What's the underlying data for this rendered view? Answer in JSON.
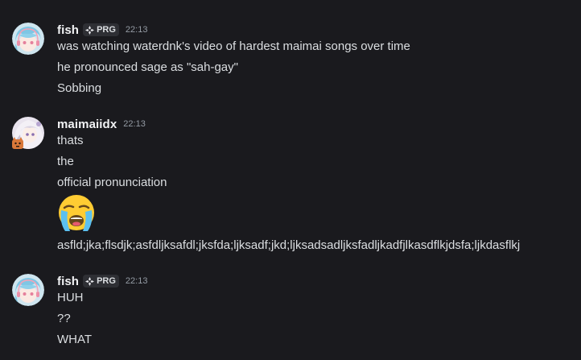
{
  "groups": [
    {
      "username": "fish",
      "tag": "PRG",
      "timestamp": "22:13",
      "avatar_icon": "anime-girl-blue-hair-avatar",
      "lines": [
        "was watching waterdnk's video of hardest maimai songs over time",
        "he pronounced sage as \"sah-gay\"",
        "Sobbing"
      ]
    },
    {
      "username": "maimaiidx",
      "timestamp": "22:13",
      "avatar_icon": "anime-girl-white-hair-avatar",
      "lines": [
        "thats",
        "the",
        "official pronunciation"
      ],
      "emoji": "loudly-crying-face-emoji",
      "last_line": "asfld;jka;flsdjk;asfdljksafdl;jksfda;ljksadf;jkd;ljksadsadljksfadljkadfjlkasdflkjdsfa;ljkdasflkj"
    },
    {
      "username": "fish",
      "tag": "PRG",
      "timestamp": "22:13",
      "avatar_icon": "anime-girl-blue-hair-avatar",
      "lines": [
        "HUH",
        "??",
        "WHAT"
      ]
    }
  ],
  "colors": {
    "background": "#1a1a1e",
    "text": "#dbdee1",
    "username": "#f2f3f5",
    "timestamp": "#949ba4",
    "tag_bg": "#2e2f34"
  }
}
